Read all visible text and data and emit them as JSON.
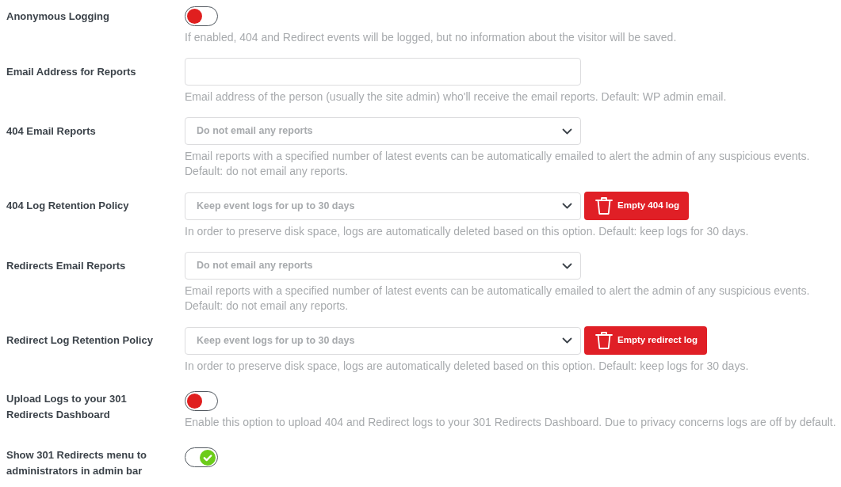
{
  "settings": [
    {
      "kind": "toggle",
      "label": "Anonymous Logging",
      "on": false,
      "help": "If enabled, 404 and Redirect events will be logged, but no information about the visitor will be saved."
    },
    {
      "kind": "text",
      "label": "Email Address for Reports",
      "help": "Email address of the person (usually the site admin) who'll receive the email reports. Default: WP admin email."
    },
    {
      "kind": "select",
      "label": "404 Email Reports",
      "value": "Do not email any reports",
      "help": "Email reports with a specified number of latest events can be automatically emailed to alert the admin of any suspicious events. Default: do not email any reports."
    },
    {
      "kind": "select",
      "label": "404 Log Retention Policy",
      "value": "Keep event logs for up to 30 days",
      "button": "Empty 404 log",
      "help": "In order to preserve disk space, logs are automatically deleted based on this option. Default: keep logs for 30 days."
    },
    {
      "kind": "select",
      "label": "Redirects Email Reports",
      "value": "Do not email any reports",
      "help": "Email reports with a specified number of latest events can be automatically emailed to alert the admin of any suspicious events. Default: do not email any reports."
    },
    {
      "kind": "select",
      "label": "Redirect Log Retention Policy",
      "value": "Keep event logs for up to 30 days",
      "button": "Empty redirect log",
      "help": "In order to preserve disk space, logs are automatically deleted based on this option. Default: keep logs for 30 days."
    },
    {
      "kind": "toggle",
      "label": "Upload Logs to your 301 Redirects Dashboard",
      "on": false,
      "help": "Enable this option to upload 404 and Redirect logs to your 301 Redirects Dashboard. Due to privacy concerns logs are off by default."
    },
    {
      "kind": "toggle",
      "label": "Show 301 Redirects menu to administrators in admin bar",
      "on": true
    }
  ]
}
